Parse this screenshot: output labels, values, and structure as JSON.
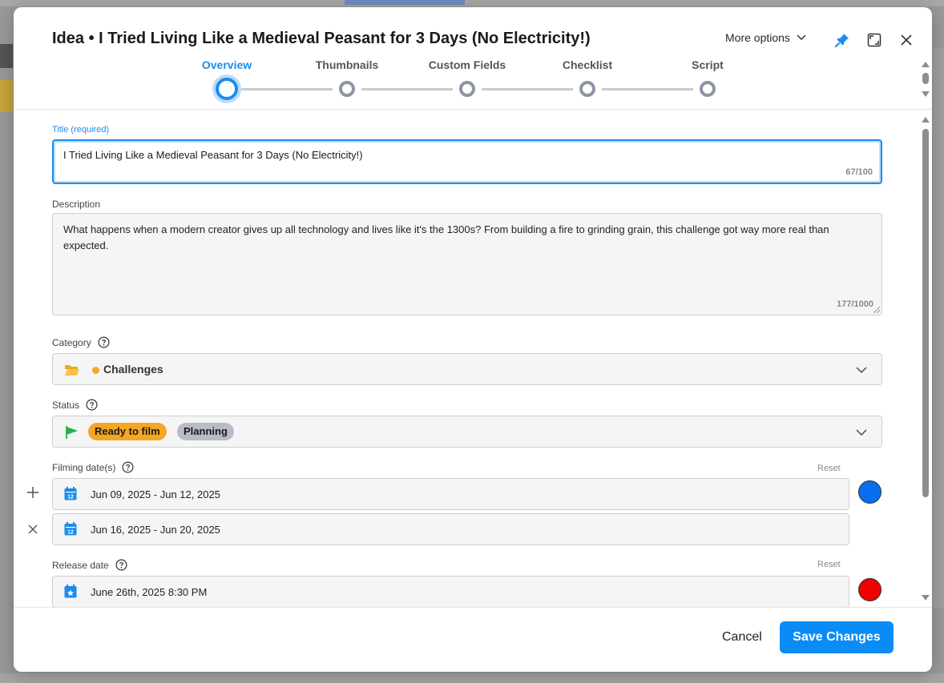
{
  "header": {
    "title_prefix": "Idea",
    "title_separator": "•",
    "title": "I Tried Living Like a Medieval Peasant for 3 Days (No Electricity!)",
    "more_options": "More options"
  },
  "stepper": {
    "steps": [
      {
        "label": "Overview",
        "active": true
      },
      {
        "label": "Thumbnails",
        "active": false
      },
      {
        "label": "Custom Fields",
        "active": false
      },
      {
        "label": "Checklist",
        "active": false
      },
      {
        "label": "Script",
        "active": false
      }
    ]
  },
  "form": {
    "title_label": "Title (required)",
    "title_value": "I Tried Living Like a Medieval Peasant for 3 Days (No Electricity!)",
    "title_counter": "67/100",
    "description_label": "Description",
    "description_value": "What happens when a modern creator gives up all technology and lives like it's the 1300s? From building a fire to grinding grain, this challenge got way more real than expected.",
    "description_counter": "177/1000",
    "category_label": "Category",
    "category_value": "Challenges",
    "status_label": "Status",
    "status_chips": [
      "Ready to film",
      "Planning"
    ],
    "filming_label": "Filming date(s)",
    "filming_reset": "Reset",
    "filming_dates": [
      "Jun 09, 2025 - Jun 12, 2025",
      "Jun 16, 2025 - Jun 20, 2025"
    ],
    "filming_color": "#0a6cf0",
    "release_label": "Release date",
    "release_reset": "Reset",
    "release_value": "June 26th, 2025 8:30 PM",
    "release_color": "#f00000",
    "calendar_day": "12"
  },
  "footer": {
    "cancel": "Cancel",
    "save": "Save Changes"
  },
  "colors": {
    "accent": "#1a8cf0",
    "status_orange": "#f5a623",
    "status_gray": "#b7bcc6",
    "flag_green": "#22b04b"
  }
}
